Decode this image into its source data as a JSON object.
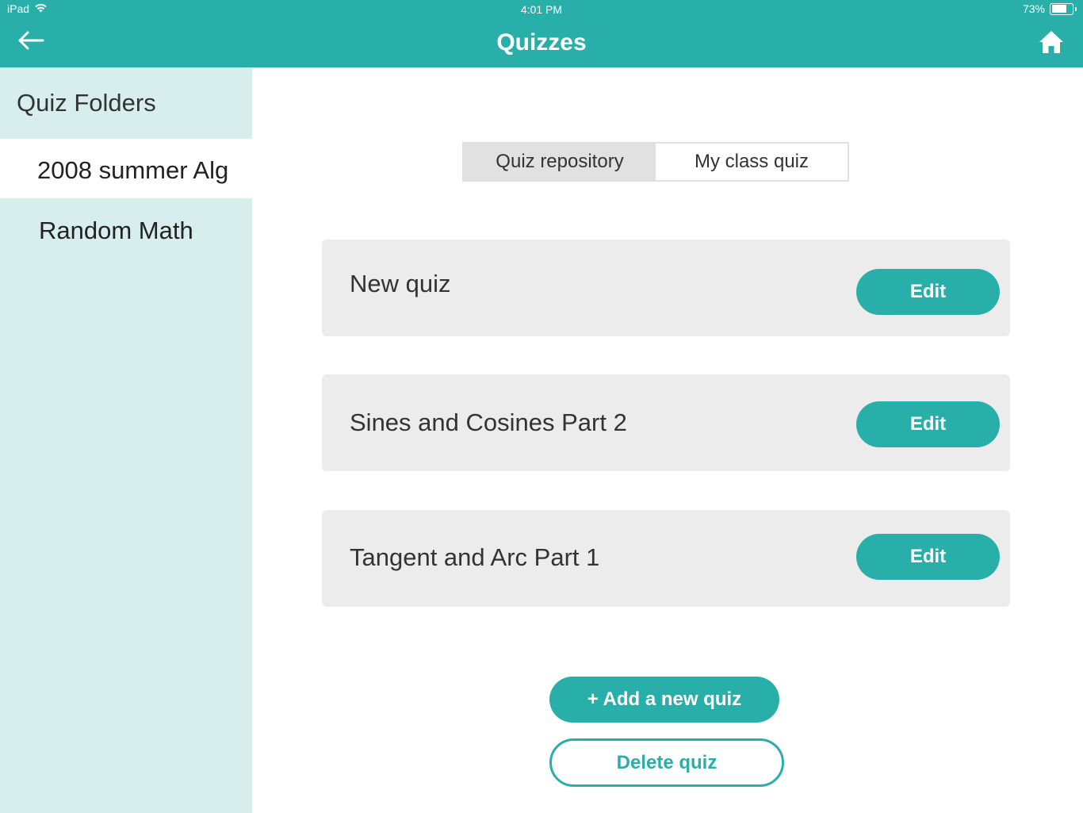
{
  "status_bar": {
    "device": "iPad",
    "time": "4:01 PM",
    "battery": "73%",
    "battery_level": 0.73,
    "wifi_icon": "wifi-icon",
    "battery_icon": "battery-icon"
  },
  "nav": {
    "title": "Quizzes",
    "back_icon": "arrow-left-icon",
    "home_icon": "home-icon"
  },
  "sidebar": {
    "title": "Quiz Folders",
    "items": [
      {
        "label": "2008 summer Alg",
        "active": true
      },
      {
        "label": "Random Math",
        "active": false
      }
    ]
  },
  "segment": {
    "options": [
      "Quiz repository",
      "My class quiz"
    ],
    "selected": "Quiz repository"
  },
  "quizzes": [
    {
      "title": "New quiz",
      "action": "Edit"
    },
    {
      "title": "Sines and Cosines Part 2",
      "action": "Edit"
    },
    {
      "title": "Tangent and Arc Part 1",
      "action": "Edit"
    }
  ],
  "actions": {
    "add_label": "+ Add a new quiz",
    "delete_label": "Delete quiz"
  },
  "colors": {
    "accent": "#29afaa",
    "sidebar_bg": "#d8eeed",
    "card_bg": "#ececec"
  }
}
